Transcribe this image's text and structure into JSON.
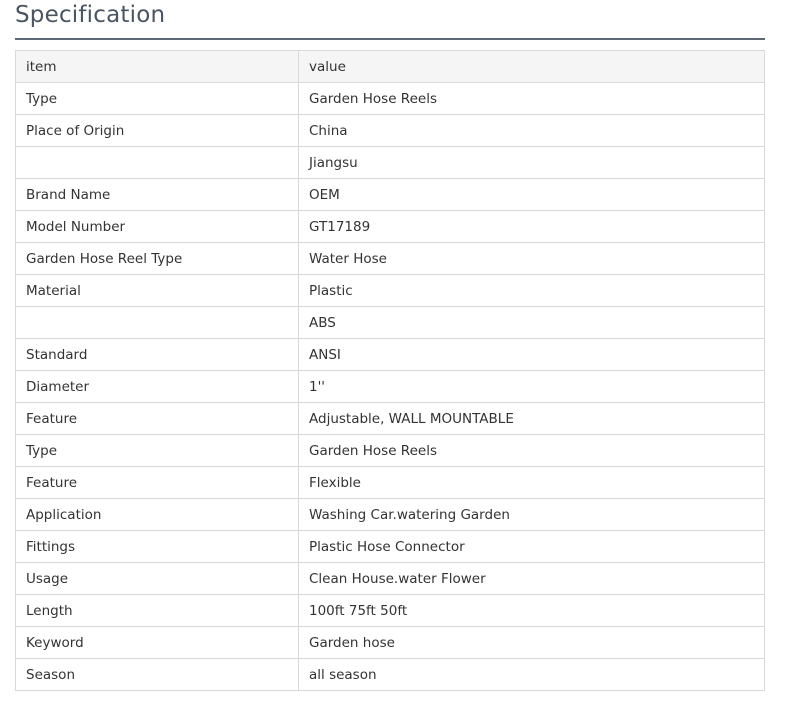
{
  "title": "Specification",
  "table": {
    "header": {
      "item": "item",
      "value": "value"
    },
    "rows": [
      {
        "item": "Type",
        "value": "Garden Hose Reels"
      },
      {
        "item": "Place of Origin",
        "value": "China"
      },
      {
        "item": "",
        "value": "Jiangsu"
      },
      {
        "item": "Brand Name",
        "value": "OEM"
      },
      {
        "item": "Model Number",
        "value": "GT17189"
      },
      {
        "item": "Garden Hose Reel Type",
        "value": "Water Hose"
      },
      {
        "item": "Material",
        "value": "Plastic"
      },
      {
        "item": "",
        "value": "ABS"
      },
      {
        "item": "Standard",
        "value": "ANSI"
      },
      {
        "item": "Diameter",
        "value": "1''"
      },
      {
        "item": "Feature",
        "value": "Adjustable, WALL MOUNTABLE"
      },
      {
        "item": "Type",
        "value": "Garden Hose Reels"
      },
      {
        "item": "Feature",
        "value": "Flexible"
      },
      {
        "item": "Application",
        "value": "Washing Car.watering Garden"
      },
      {
        "item": "Fittings",
        "value": "Plastic Hose Connector"
      },
      {
        "item": "Usage",
        "value": "Clean House.water Flower"
      },
      {
        "item": "Length",
        "value": "100ft 75ft 50ft"
      },
      {
        "item": "Keyword",
        "value": "Garden hose"
      },
      {
        "item": "Season",
        "value": "all season"
      }
    ]
  }
}
